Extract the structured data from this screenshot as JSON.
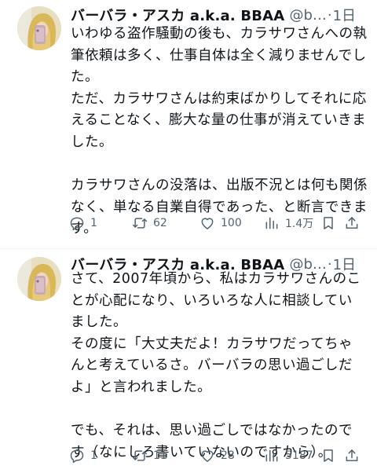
{
  "tweets": [
    {
      "display_name": "バーバラ・アスカ a.k.a. BBAA",
      "handle": "@b…",
      "dot": "·",
      "time": "1日",
      "lines": [
        "いわゆる盗作騒動の後も、カラサワさんへの執",
        "筆依頼は多く、仕事自体は全く減りませんでし",
        "た。",
        "ただ、カラサワさんは約束ばかりしてそれに応",
        "えることなく、膨大な量の仕事が消えていきま",
        "した。",
        "",
        "カラサワさんの没落は、出版不況とは何も関係",
        "なく、単なる自業自得であった、と断言できま",
        "す。"
      ],
      "replies": "1",
      "reposts": "62",
      "likes": "100",
      "views": "1.4万"
    },
    {
      "display_name": "バーバラ・アスカ a.k.a. BBAA",
      "handle": "@b…",
      "dot": "·",
      "time": "1日",
      "lines": [
        "さて、2007年頃から、私はカラサワさんのこ",
        "とが心配になり、いろいろな人に相談してい",
        "ました。",
        "その度に「大丈夫だよ！カラサワだってちゃ",
        "んと考えているさ。バーバラの思い過ごしだ",
        "よ」と言われました。",
        "",
        "でも、それは、思い過ごしではなかったので",
        "す（なにしろ書いていないのですから）。"
      ],
      "replies": "1",
      "reposts": "11",
      "likes": "28",
      "views": "5187"
    }
  ],
  "icons": {
    "reply": "speech-bubble",
    "repost": "two-arrows-loop",
    "like": "heart",
    "views": "bar-chart",
    "bookmark": "bookmark",
    "share": "upload-arrow"
  },
  "colors": {
    "text": "#0f1419",
    "muted": "#536471",
    "divider": "#eff3f4"
  }
}
